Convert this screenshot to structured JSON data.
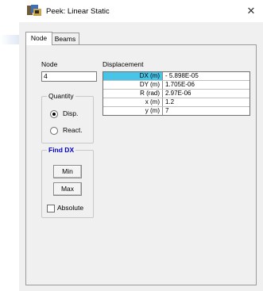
{
  "window": {
    "title": "Peek: Linear Static"
  },
  "tabs": [
    {
      "label": "Node"
    },
    {
      "label": "Beams"
    }
  ],
  "node": {
    "label": "Node",
    "value": "4"
  },
  "quantity": {
    "title": "Quantity",
    "options": [
      {
        "label": "Disp.",
        "selected": true
      },
      {
        "label": "React.",
        "selected": false
      }
    ]
  },
  "find": {
    "title": "Find DX",
    "title_color": "#0000cc",
    "min_label": "Min",
    "max_label": "Max",
    "absolute_label": "Absolute",
    "absolute_checked": false
  },
  "displacement": {
    "label": "Displacement",
    "selected_color": "#46c5e8",
    "rows": [
      {
        "name": "DX (m)",
        "value": "- 5.898E-05"
      },
      {
        "name": "DY (m)",
        "value": "1.705E-06"
      },
      {
        "name": "R (rad)",
        "value": "2.97E-06"
      },
      {
        "name": "x (m)",
        "value": "1.2"
      },
      {
        "name": "y (m)",
        "value": "7"
      }
    ]
  }
}
